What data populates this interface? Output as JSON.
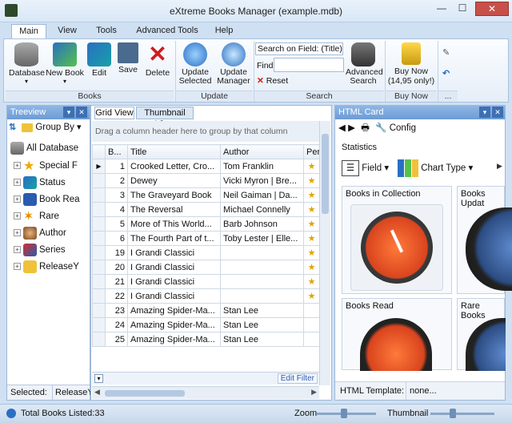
{
  "window": {
    "title": "eXtreme Books Manager (example.mdb)"
  },
  "tabs": [
    "Main",
    "View",
    "Tools",
    "Advanced Tools",
    "Help"
  ],
  "ribbon": {
    "books_group": {
      "label": "Books",
      "buttons": [
        "Database",
        "New Book",
        "Edit",
        "Save",
        "Delete"
      ]
    },
    "update_group": {
      "label": "Update",
      "buttons": [
        "Update Selected",
        "Update Manager"
      ]
    },
    "search_group": {
      "label": "Search",
      "search_field": "Search on Field: (Title)",
      "find_label": "Find",
      "find_value": "",
      "reset": "Reset",
      "advanced": "Advanced Search"
    },
    "buynow_group": {
      "label": "Buy Now",
      "button": "Buy Now",
      "price": "(14,95 only!)"
    },
    "more": "..."
  },
  "treeview": {
    "title": "Treeview",
    "group_by": "Group By",
    "root": "All Database",
    "items": [
      "Special F",
      "Status",
      "Book Rea",
      "Rare",
      "Author",
      "Series",
      "ReleaseY"
    ],
    "selected_label": "Selected:",
    "selected_value": "ReleaseYe"
  },
  "grid": {
    "tabs": [
      "Grid View",
      "Thumbnail View"
    ],
    "group_hint": "Drag a column header here to group by that column",
    "columns": [
      "B...",
      "Title",
      "Author",
      "Per"
    ],
    "rows": [
      [
        "1",
        "Crooked Letter, Cro...",
        "Tom Franklin",
        "★"
      ],
      [
        "2",
        "Dewey",
        "Vicki Myron | Bre...",
        "★"
      ],
      [
        "3",
        "The Graveyard Book",
        "Neil Gaiman | Da...",
        "★"
      ],
      [
        "4",
        "The Reversal",
        "Michael Connelly",
        "★"
      ],
      [
        "5",
        "More of This World...",
        "Barb Johnson",
        "★"
      ],
      [
        "6",
        "The Fourth Part of t...",
        "Toby Lester | Elle...",
        "★"
      ],
      [
        "19",
        "I Grandi Classici",
        "",
        "★"
      ],
      [
        "20",
        "I Grandi Classici",
        "",
        "★"
      ],
      [
        "21",
        "I Grandi Classici",
        "",
        "★"
      ],
      [
        "22",
        "I Grandi Classici",
        "",
        "★"
      ],
      [
        "23",
        "Amazing Spider-Ma...",
        "Stan Lee",
        ""
      ],
      [
        "24",
        "Amazing Spider-Ma...",
        "Stan Lee",
        ""
      ],
      [
        "25",
        "Amazing Spider-Ma...",
        "Stan Lee",
        ""
      ]
    ],
    "edit_filter": "Edit Filter"
  },
  "htmlcard": {
    "title": "HTML Card",
    "config": "Config",
    "statistics": "Statistics",
    "field_btn": "Field",
    "chart_type_btn": "Chart Type",
    "cards": [
      "Books in Collection",
      "Books Updat",
      "Books Read",
      "Rare Books"
    ],
    "template_label": "HTML Template:",
    "template_value": "none..."
  },
  "status": {
    "total": "Total Books Listed:33",
    "zoom": "Zoom",
    "thumbnail": "Thumbnail"
  },
  "colors": {
    "accent": "#3d6fb3",
    "close": "#c7504b",
    "gauge_red": "#d9441e",
    "gauge_blue": "#2c4d83"
  }
}
